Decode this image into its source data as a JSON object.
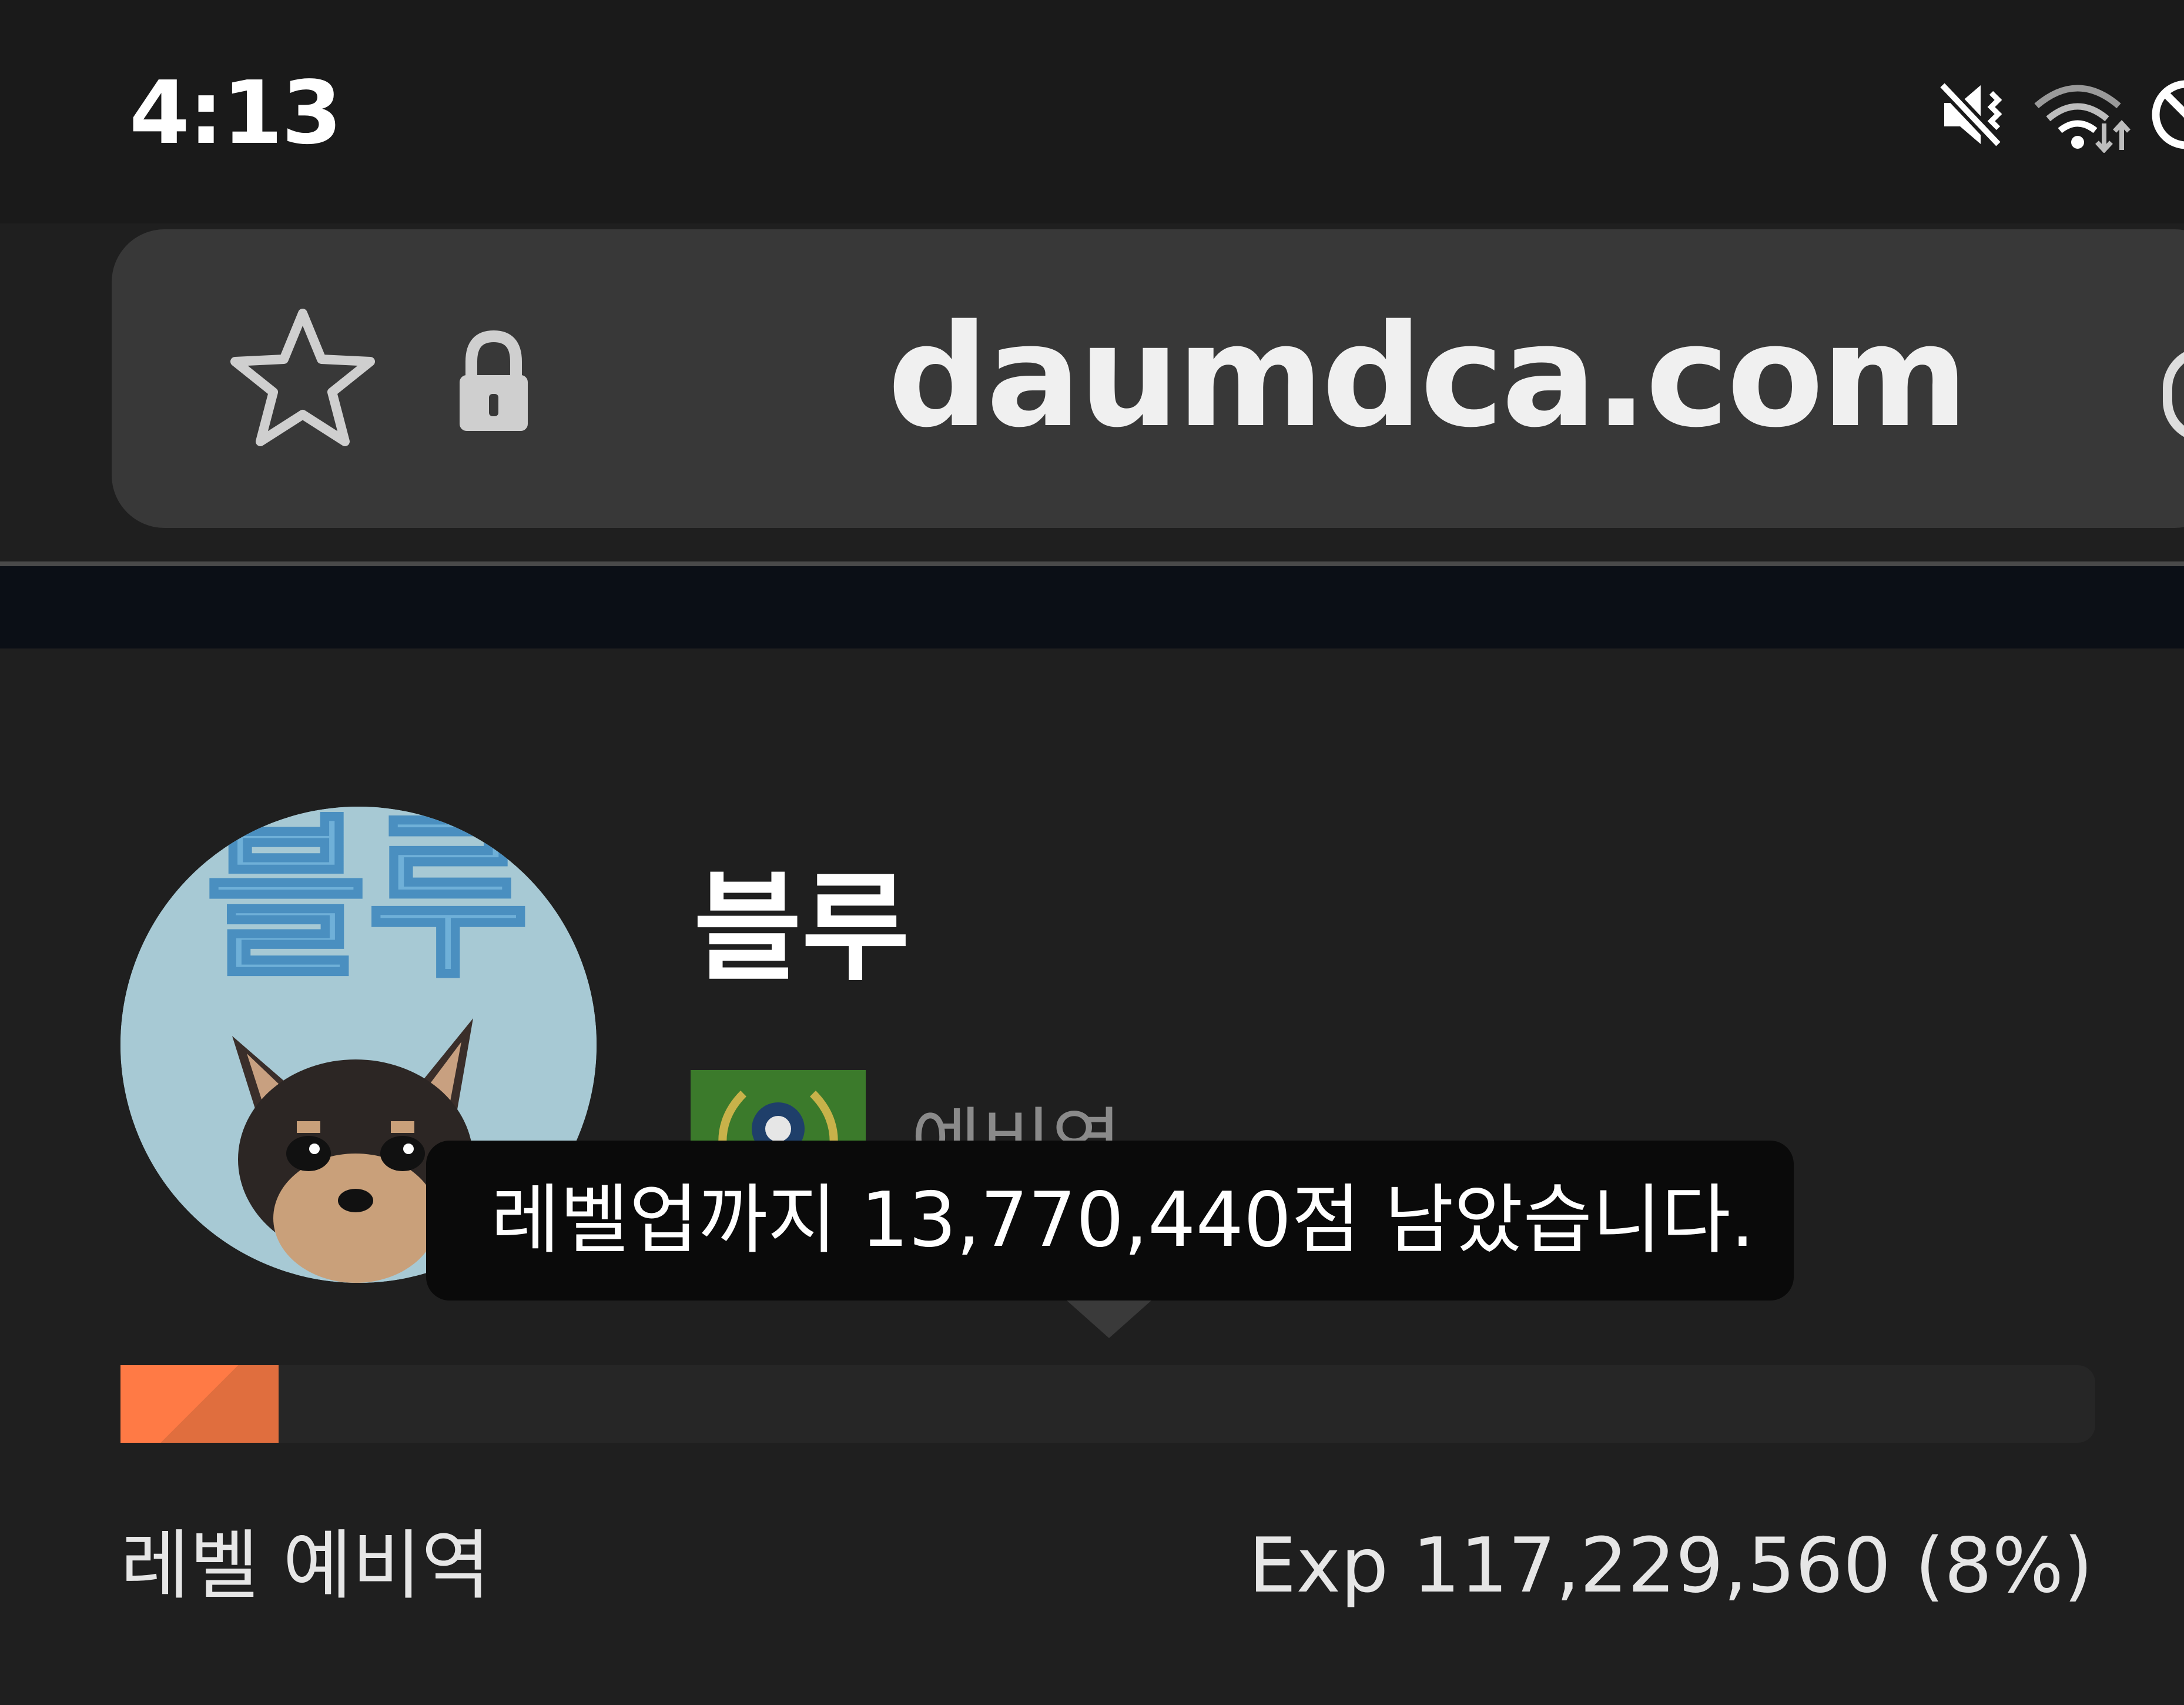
{
  "status_bar": {
    "time": "4:13",
    "icons": [
      "mute-vibrate-icon",
      "wifi-icon",
      "data-saver-icon"
    ]
  },
  "browser": {
    "url": "daumdca.com",
    "icons": [
      "star-icon",
      "lock-icon"
    ]
  },
  "profile": {
    "avatar_text": "블루",
    "nickname": "블루",
    "rank_text": "예비역",
    "tooltip": "레벨업까지 13,770,440점 남았습니다.",
    "progress_fraction": 0.08,
    "progress_color": "#ff7a45",
    "level_label": "레벨 예비역",
    "exp_label": "Exp 117,229,560 (8%)"
  }
}
